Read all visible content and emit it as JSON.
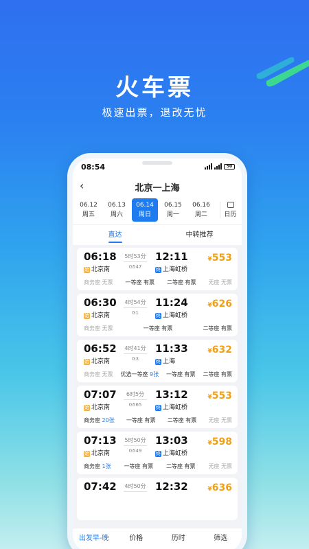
{
  "hero": {
    "title": "火车票",
    "subtitle": "极速出票，退改无忧"
  },
  "status": {
    "time": "08:54",
    "battery": "50"
  },
  "nav": {
    "back_icon": "‹",
    "route": "北京一上海"
  },
  "dates": [
    {
      "date": "06.12",
      "day": "周五"
    },
    {
      "date": "06.13",
      "day": "周六"
    },
    {
      "date": "06.14",
      "day": "周日",
      "active": true
    },
    {
      "date": "06.15",
      "day": "周一"
    },
    {
      "date": "06.16",
      "day": "周二"
    }
  ],
  "calendar_label": "日历",
  "tabs": {
    "direct": "直达",
    "transfer": "中转推荐"
  },
  "trains": [
    {
      "dep": "06:18",
      "arr": "12:11",
      "dur": "5时53分",
      "no": "G547",
      "from": "北京南",
      "to": "上海虹桥",
      "price": "553",
      "seats": [
        {
          "t": "商务座 无票",
          "s": "no"
        },
        {
          "t": "一等座 有票",
          "s": ""
        },
        {
          "t": "二等座 有票",
          "s": ""
        },
        {
          "t": "无座 无票",
          "s": "no"
        }
      ]
    },
    {
      "dep": "06:30",
      "arr": "11:24",
      "dur": "4时54分",
      "no": "G1",
      "from": "北京南",
      "to": "上海虹桥",
      "price": "626",
      "seats": [
        {
          "t": "商务座 无票",
          "s": "no"
        },
        {
          "t": "一等座 有票",
          "s": ""
        },
        {
          "t": "二等座 有票",
          "s": ""
        }
      ]
    },
    {
      "dep": "06:52",
      "arr": "11:33",
      "dur": "4时41分",
      "no": "G3",
      "from": "北京南",
      "to": "上海",
      "price": "632",
      "seats": [
        {
          "t": "商务座 无票",
          "s": "no"
        },
        {
          "t": "优选一等座 9张",
          "s": ""
        },
        {
          "t": "一等座 有票",
          "s": ""
        },
        {
          "t": "二等座 有票",
          "s": ""
        }
      ]
    },
    {
      "dep": "07:07",
      "arr": "13:12",
      "dur": "6时5分",
      "no": "G565",
      "from": "北京南",
      "to": "上海虹桥",
      "price": "553",
      "seats": [
        {
          "t": "商务座 20张",
          "s": ""
        },
        {
          "t": "一等座 有票",
          "s": ""
        },
        {
          "t": "二等座 有票",
          "s": ""
        },
        {
          "t": "无座 无票",
          "s": "no"
        }
      ]
    },
    {
      "dep": "07:13",
      "arr": "13:03",
      "dur": "5时50分",
      "no": "G549",
      "from": "北京南",
      "to": "上海虹桥",
      "price": "598",
      "seats": [
        {
          "t": "商务座 1张",
          "s": ""
        },
        {
          "t": "一等座 有票",
          "s": ""
        },
        {
          "t": "二等座 有票",
          "s": ""
        },
        {
          "t": "无座 无票",
          "s": "no"
        }
      ]
    },
    {
      "dep": "07:42",
      "arr": "12:32",
      "dur": "4时50分",
      "no": "",
      "from": "",
      "to": "",
      "price": "636",
      "seats": []
    }
  ],
  "bottom": {
    "sort_time": "出发早-晚",
    "price": "价格",
    "duration": "历时",
    "filter": "筛选"
  },
  "labels": {
    "start_tag": "始",
    "end_tag": "终",
    "currency": "¥"
  },
  "colors": {
    "accent": "#1e7cf0",
    "price": "#f0a015"
  }
}
